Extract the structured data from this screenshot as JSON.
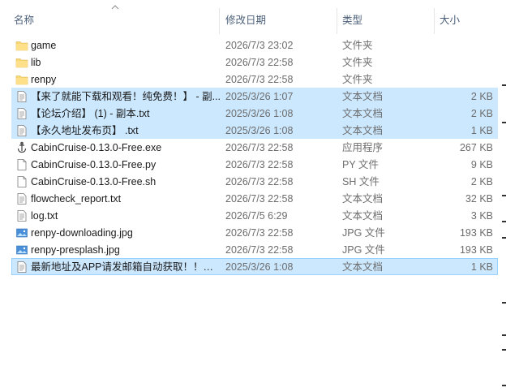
{
  "columns": {
    "name": "名称",
    "date": "修改日期",
    "type": "类型",
    "size": "大小"
  },
  "files": [
    {
      "icon": "folder-icon",
      "name": "game",
      "date": "2026/7/3 23:02",
      "type": "文件夹",
      "size": "",
      "selected": false
    },
    {
      "icon": "folder-icon",
      "name": "lib",
      "date": "2026/7/3 22:58",
      "type": "文件夹",
      "size": "",
      "selected": false
    },
    {
      "icon": "folder-icon",
      "name": "renpy",
      "date": "2026/7/3 22:58",
      "type": "文件夹",
      "size": "",
      "selected": false
    },
    {
      "icon": "text-file-icon",
      "name": "【来了就能下载和观看！纯免费！】 - 副...",
      "date": "2025/3/26 1:07",
      "type": "文本文档",
      "size": "2 KB",
      "selected": true
    },
    {
      "icon": "text-file-icon",
      "name": "【论坛介绍】 (1) - 副本.txt",
      "date": "2025/3/26 1:08",
      "type": "文本文档",
      "size": "2 KB",
      "selected": true
    },
    {
      "icon": "text-file-icon",
      "name": "【永久地址发布页】 .txt",
      "date": "2025/3/26 1:08",
      "type": "文本文档",
      "size": "1 KB",
      "selected": true
    },
    {
      "icon": "renpy-app-icon",
      "name": "CabinCruise-0.13.0-Free.exe",
      "date": "2026/7/3 22:58",
      "type": "应用程序",
      "size": "267 KB",
      "selected": false
    },
    {
      "icon": "blank-file-icon",
      "name": "CabinCruise-0.13.0-Free.py",
      "date": "2026/7/3 22:58",
      "type": "PY 文件",
      "size": "9 KB",
      "selected": false
    },
    {
      "icon": "blank-file-icon",
      "name": "CabinCruise-0.13.0-Free.sh",
      "date": "2026/7/3 22:58",
      "type": "SH 文件",
      "size": "2 KB",
      "selected": false
    },
    {
      "icon": "text-file-icon",
      "name": "flowcheck_report.txt",
      "date": "2026/7/3 22:58",
      "type": "文本文档",
      "size": "32 KB",
      "selected": false
    },
    {
      "icon": "text-file-icon",
      "name": "log.txt",
      "date": "2026/7/5 6:29",
      "type": "文本文档",
      "size": "3 KB",
      "selected": false
    },
    {
      "icon": "image-file-icon",
      "name": "renpy-downloading.jpg",
      "date": "2026/7/3 22:58",
      "type": "JPG 文件",
      "size": "193 KB",
      "selected": false
    },
    {
      "icon": "image-file-icon",
      "name": "renpy-presplash.jpg",
      "date": "2026/7/3 22:58",
      "type": "JPG 文件",
      "size": "193 KB",
      "selected": false
    },
    {
      "icon": "text-file-icon",
      "name": "最新地址及APP请发邮箱自动获取！！！...",
      "date": "2025/3/26 1:08",
      "type": "文本文档",
      "size": "1 KB",
      "selected": true,
      "focused": true
    }
  ],
  "colors": {
    "selection": "#cce8ff",
    "selection_border": "#99d1ff",
    "folder": "#f8d775",
    "header_text": "#4c607a"
  }
}
